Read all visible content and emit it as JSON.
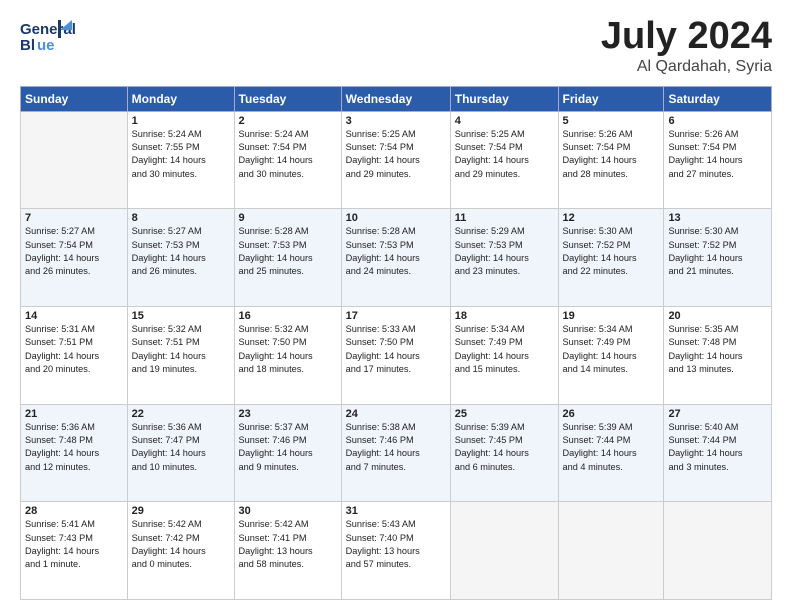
{
  "header": {
    "logo_line1": "General",
    "logo_line2": "Blue",
    "month": "July 2024",
    "location": "Al Qardahah, Syria"
  },
  "days_of_week": [
    "Sunday",
    "Monday",
    "Tuesday",
    "Wednesday",
    "Thursday",
    "Friday",
    "Saturday"
  ],
  "weeks": [
    [
      {
        "day": "",
        "info": ""
      },
      {
        "day": "1",
        "info": "Sunrise: 5:24 AM\nSunset: 7:55 PM\nDaylight: 14 hours\nand 30 minutes."
      },
      {
        "day": "2",
        "info": "Sunrise: 5:24 AM\nSunset: 7:54 PM\nDaylight: 14 hours\nand 30 minutes."
      },
      {
        "day": "3",
        "info": "Sunrise: 5:25 AM\nSunset: 7:54 PM\nDaylight: 14 hours\nand 29 minutes."
      },
      {
        "day": "4",
        "info": "Sunrise: 5:25 AM\nSunset: 7:54 PM\nDaylight: 14 hours\nand 29 minutes."
      },
      {
        "day": "5",
        "info": "Sunrise: 5:26 AM\nSunset: 7:54 PM\nDaylight: 14 hours\nand 28 minutes."
      },
      {
        "day": "6",
        "info": "Sunrise: 5:26 AM\nSunset: 7:54 PM\nDaylight: 14 hours\nand 27 minutes."
      }
    ],
    [
      {
        "day": "7",
        "info": "Sunrise: 5:27 AM\nSunset: 7:54 PM\nDaylight: 14 hours\nand 26 minutes."
      },
      {
        "day": "8",
        "info": "Sunrise: 5:27 AM\nSunset: 7:53 PM\nDaylight: 14 hours\nand 26 minutes."
      },
      {
        "day": "9",
        "info": "Sunrise: 5:28 AM\nSunset: 7:53 PM\nDaylight: 14 hours\nand 25 minutes."
      },
      {
        "day": "10",
        "info": "Sunrise: 5:28 AM\nSunset: 7:53 PM\nDaylight: 14 hours\nand 24 minutes."
      },
      {
        "day": "11",
        "info": "Sunrise: 5:29 AM\nSunset: 7:53 PM\nDaylight: 14 hours\nand 23 minutes."
      },
      {
        "day": "12",
        "info": "Sunrise: 5:30 AM\nSunset: 7:52 PM\nDaylight: 14 hours\nand 22 minutes."
      },
      {
        "day": "13",
        "info": "Sunrise: 5:30 AM\nSunset: 7:52 PM\nDaylight: 14 hours\nand 21 minutes."
      }
    ],
    [
      {
        "day": "14",
        "info": "Sunrise: 5:31 AM\nSunset: 7:51 PM\nDaylight: 14 hours\nand 20 minutes."
      },
      {
        "day": "15",
        "info": "Sunrise: 5:32 AM\nSunset: 7:51 PM\nDaylight: 14 hours\nand 19 minutes."
      },
      {
        "day": "16",
        "info": "Sunrise: 5:32 AM\nSunset: 7:50 PM\nDaylight: 14 hours\nand 18 minutes."
      },
      {
        "day": "17",
        "info": "Sunrise: 5:33 AM\nSunset: 7:50 PM\nDaylight: 14 hours\nand 17 minutes."
      },
      {
        "day": "18",
        "info": "Sunrise: 5:34 AM\nSunset: 7:49 PM\nDaylight: 14 hours\nand 15 minutes."
      },
      {
        "day": "19",
        "info": "Sunrise: 5:34 AM\nSunset: 7:49 PM\nDaylight: 14 hours\nand 14 minutes."
      },
      {
        "day": "20",
        "info": "Sunrise: 5:35 AM\nSunset: 7:48 PM\nDaylight: 14 hours\nand 13 minutes."
      }
    ],
    [
      {
        "day": "21",
        "info": "Sunrise: 5:36 AM\nSunset: 7:48 PM\nDaylight: 14 hours\nand 12 minutes."
      },
      {
        "day": "22",
        "info": "Sunrise: 5:36 AM\nSunset: 7:47 PM\nDaylight: 14 hours\nand 10 minutes."
      },
      {
        "day": "23",
        "info": "Sunrise: 5:37 AM\nSunset: 7:46 PM\nDaylight: 14 hours\nand 9 minutes."
      },
      {
        "day": "24",
        "info": "Sunrise: 5:38 AM\nSunset: 7:46 PM\nDaylight: 14 hours\nand 7 minutes."
      },
      {
        "day": "25",
        "info": "Sunrise: 5:39 AM\nSunset: 7:45 PM\nDaylight: 14 hours\nand 6 minutes."
      },
      {
        "day": "26",
        "info": "Sunrise: 5:39 AM\nSunset: 7:44 PM\nDaylight: 14 hours\nand 4 minutes."
      },
      {
        "day": "27",
        "info": "Sunrise: 5:40 AM\nSunset: 7:44 PM\nDaylight: 14 hours\nand 3 minutes."
      }
    ],
    [
      {
        "day": "28",
        "info": "Sunrise: 5:41 AM\nSunset: 7:43 PM\nDaylight: 14 hours\nand 1 minute."
      },
      {
        "day": "29",
        "info": "Sunrise: 5:42 AM\nSunset: 7:42 PM\nDaylight: 14 hours\nand 0 minutes."
      },
      {
        "day": "30",
        "info": "Sunrise: 5:42 AM\nSunset: 7:41 PM\nDaylight: 13 hours\nand 58 minutes."
      },
      {
        "day": "31",
        "info": "Sunrise: 5:43 AM\nSunset: 7:40 PM\nDaylight: 13 hours\nand 57 minutes."
      },
      {
        "day": "",
        "info": ""
      },
      {
        "day": "",
        "info": ""
      },
      {
        "day": "",
        "info": ""
      }
    ]
  ]
}
